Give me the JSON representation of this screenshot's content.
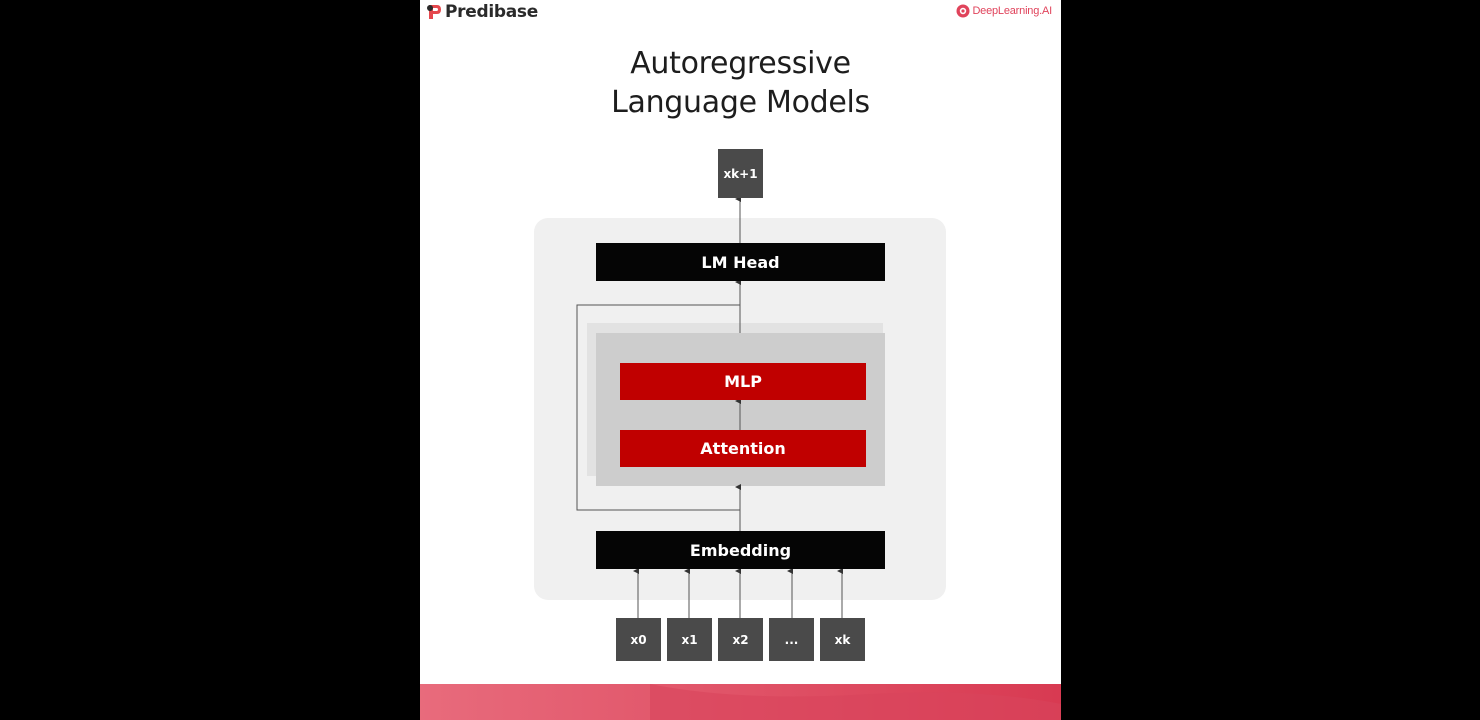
{
  "header": {
    "left_logo": {
      "text": "Predibase",
      "icon": "predibase-logo-icon"
    },
    "right_logo": {
      "text": "DeepLearning.AI",
      "icon": "deeplearning-ai-logo-icon"
    }
  },
  "title": {
    "line1": "Autoregressive",
    "line2": "Language Models"
  },
  "diagram": {
    "output": "xk+1",
    "lm_head": "LM Head",
    "mlp": "MLP",
    "attention": "Attention",
    "embedding": "Embedding",
    "inputs": [
      "x0",
      "x1",
      "x2",
      "...",
      "xk"
    ]
  },
  "colors": {
    "accent_red": "#c00000",
    "black_block": "#050505",
    "token_gray": "#4a4a4a",
    "panel_gray": "#f0f0f0",
    "footer_pink": "#e05a6e"
  }
}
